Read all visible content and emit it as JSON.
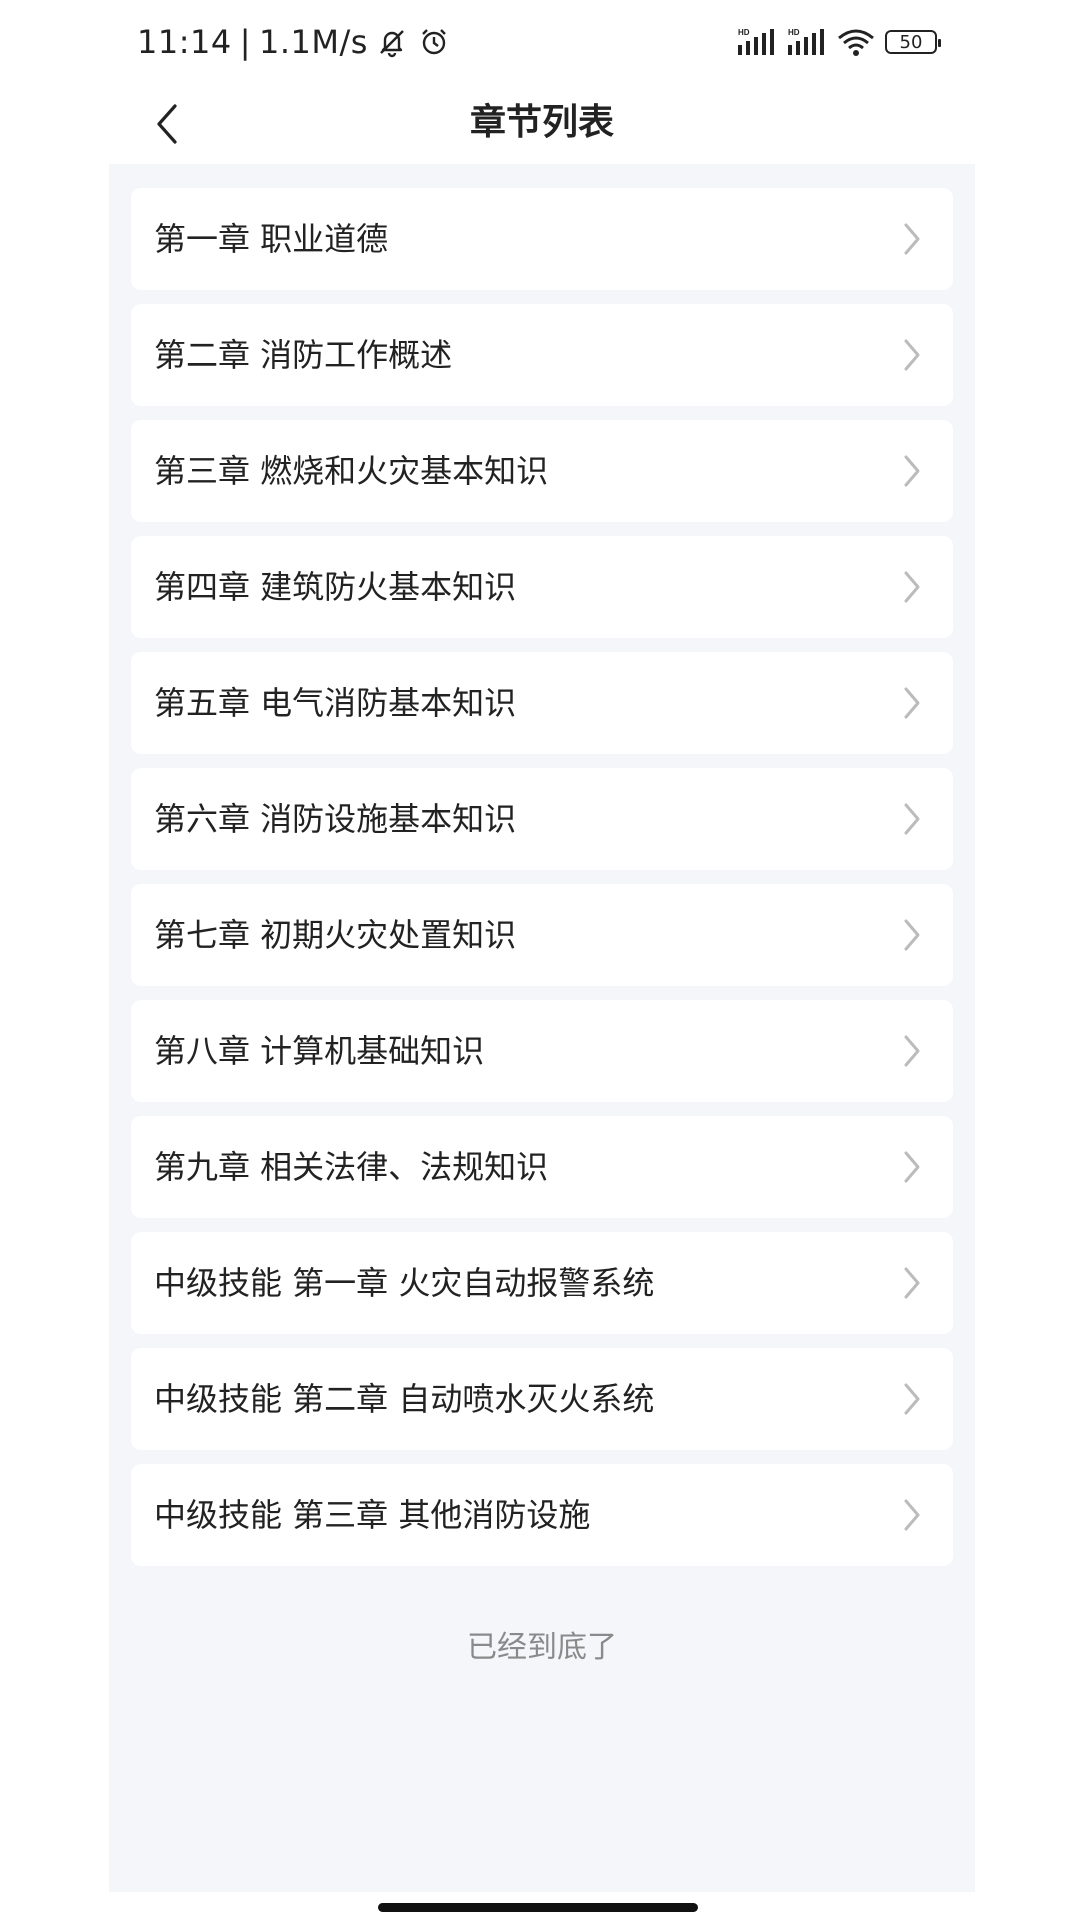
{
  "status_bar": {
    "time": "11:14",
    "separator": "|",
    "net_speed": "1.1M/s",
    "mute_icon": "bell-off-icon",
    "alarm_icon": "alarm-clock-icon",
    "signal1_label": "HD",
    "signal2_label": "HD",
    "wifi_icon": "wifi-icon",
    "battery_level": "50"
  },
  "header": {
    "back_icon": "chevron-left-icon",
    "title": "章节列表"
  },
  "chapters": [
    {
      "label": "第一章 职业道德"
    },
    {
      "label": "第二章 消防工作概述"
    },
    {
      "label": "第三章 燃烧和火灾基本知识"
    },
    {
      "label": "第四章 建筑防火基本知识"
    },
    {
      "label": "第五章 电气消防基本知识"
    },
    {
      "label": "第六章 消防设施基本知识"
    },
    {
      "label": "第七章 初期火灾处置知识"
    },
    {
      "label": "第八章 计算机基础知识"
    },
    {
      "label": "第九章 相关法律、法规知识"
    },
    {
      "label": "中级技能 第一章 火灾自动报警系统"
    },
    {
      "label": "中级技能 第二章 自动喷水灭火系统"
    },
    {
      "label": "中级技能 第三章 其他消防设施"
    }
  ],
  "footer": {
    "end_text": "已经到底了"
  },
  "colors": {
    "background": "#f5f6fa",
    "card": "#ffffff",
    "text": "#222222",
    "muted": "#8a8a8a",
    "chevron": "#bbbbbb"
  }
}
